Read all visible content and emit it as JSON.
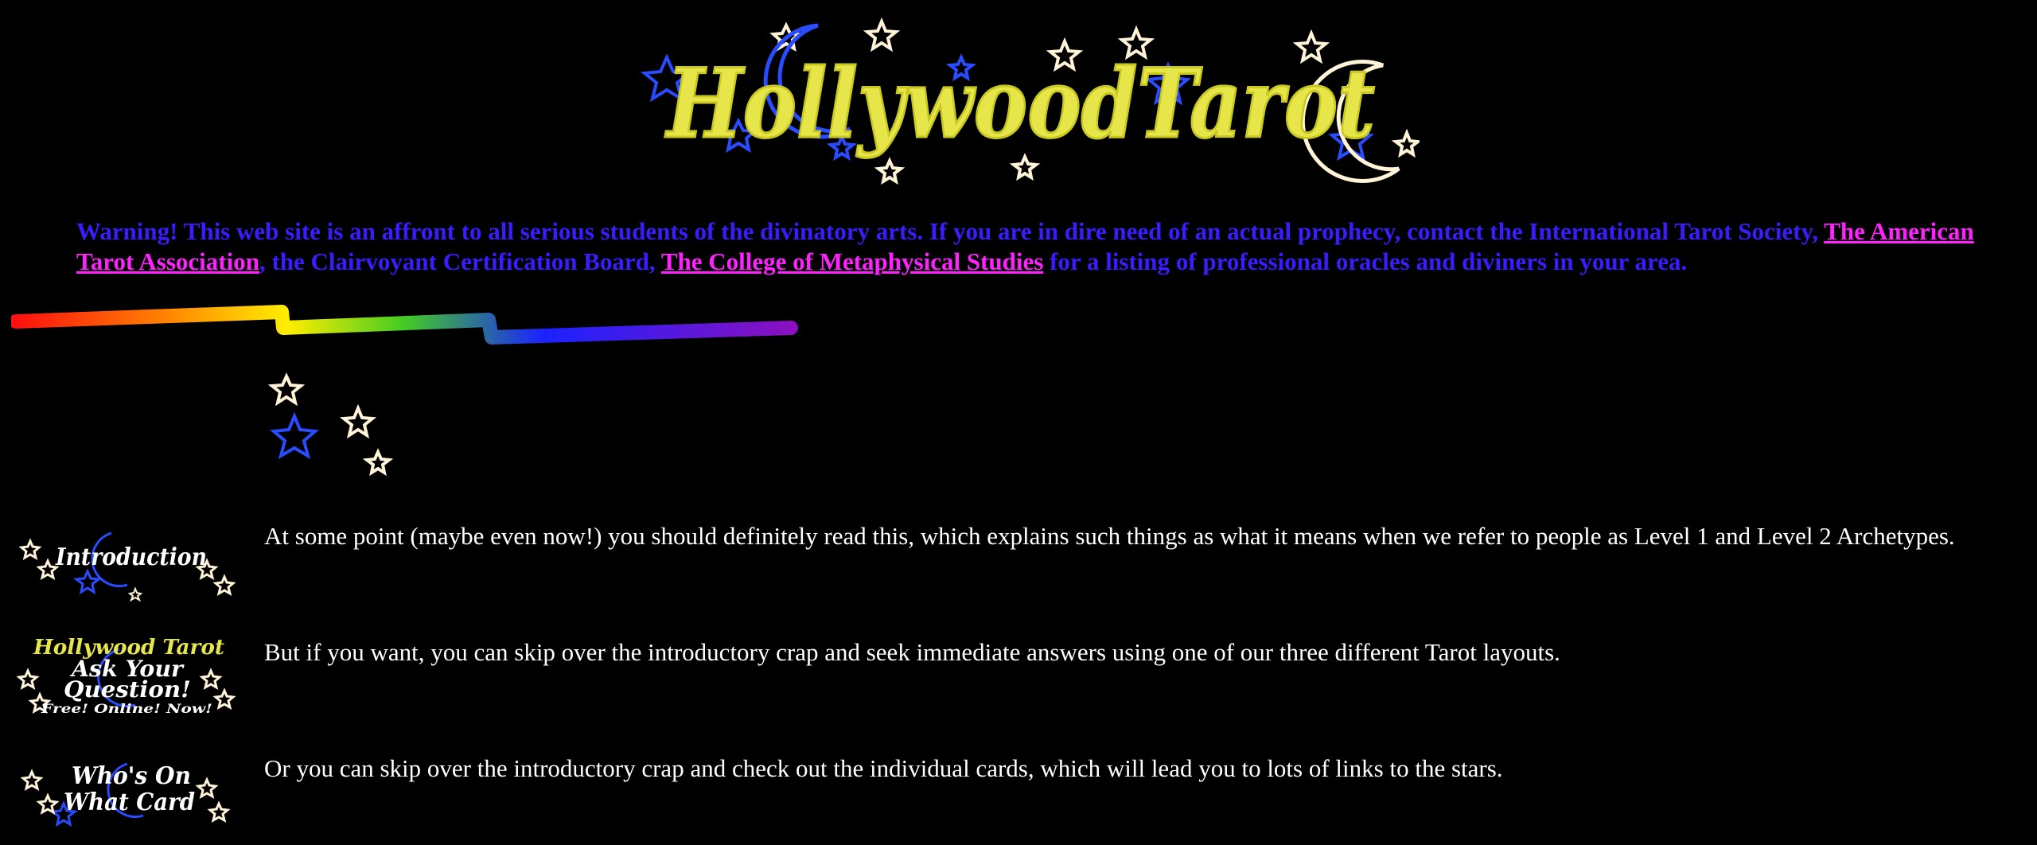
{
  "header": {
    "logo_text": "HollywoodTarot"
  },
  "warning": {
    "text_part1": "Warning! This web site is an affront to all serious students of the divinatory arts. If you are in dire need of an actual prophecy, contact the International Tarot Society, ",
    "link1": "The American Tarot Association",
    "text_part2": ", the Clairvoyant Certification Board, ",
    "link2": "The College of Metaphysical Studies",
    "text_part3": " for a listing of professional oracles and diviners in your area."
  },
  "nav": [
    {
      "button_label": "Introduction",
      "text": "At some point (maybe even now!) you should definitely read this, which explains such things as what it means when we refer to people as Level 1 and Level 2 Archetypes."
    },
    {
      "button_line1": "Hollywood Tarot",
      "button_line2": "Ask Your",
      "button_line3": "Question!",
      "button_line4": "Free! Online! Now!",
      "text": "But if you want, you can skip over the introductory crap and seek immediate answers using one of our three different Tarot layouts."
    },
    {
      "button_line1": "Who's On",
      "button_line2": "What Card",
      "text": "Or you can skip over the introductory crap and check out the individual cards, which will lead you to lots of links to the stars."
    }
  ],
  "colors": {
    "background": "#000000",
    "warning_text": "#3a1cff",
    "link": "#ff22ff",
    "logo_yellow": "#e6e64a",
    "star_blue": "#2a4cff",
    "star_cream": "#fff4d8"
  }
}
